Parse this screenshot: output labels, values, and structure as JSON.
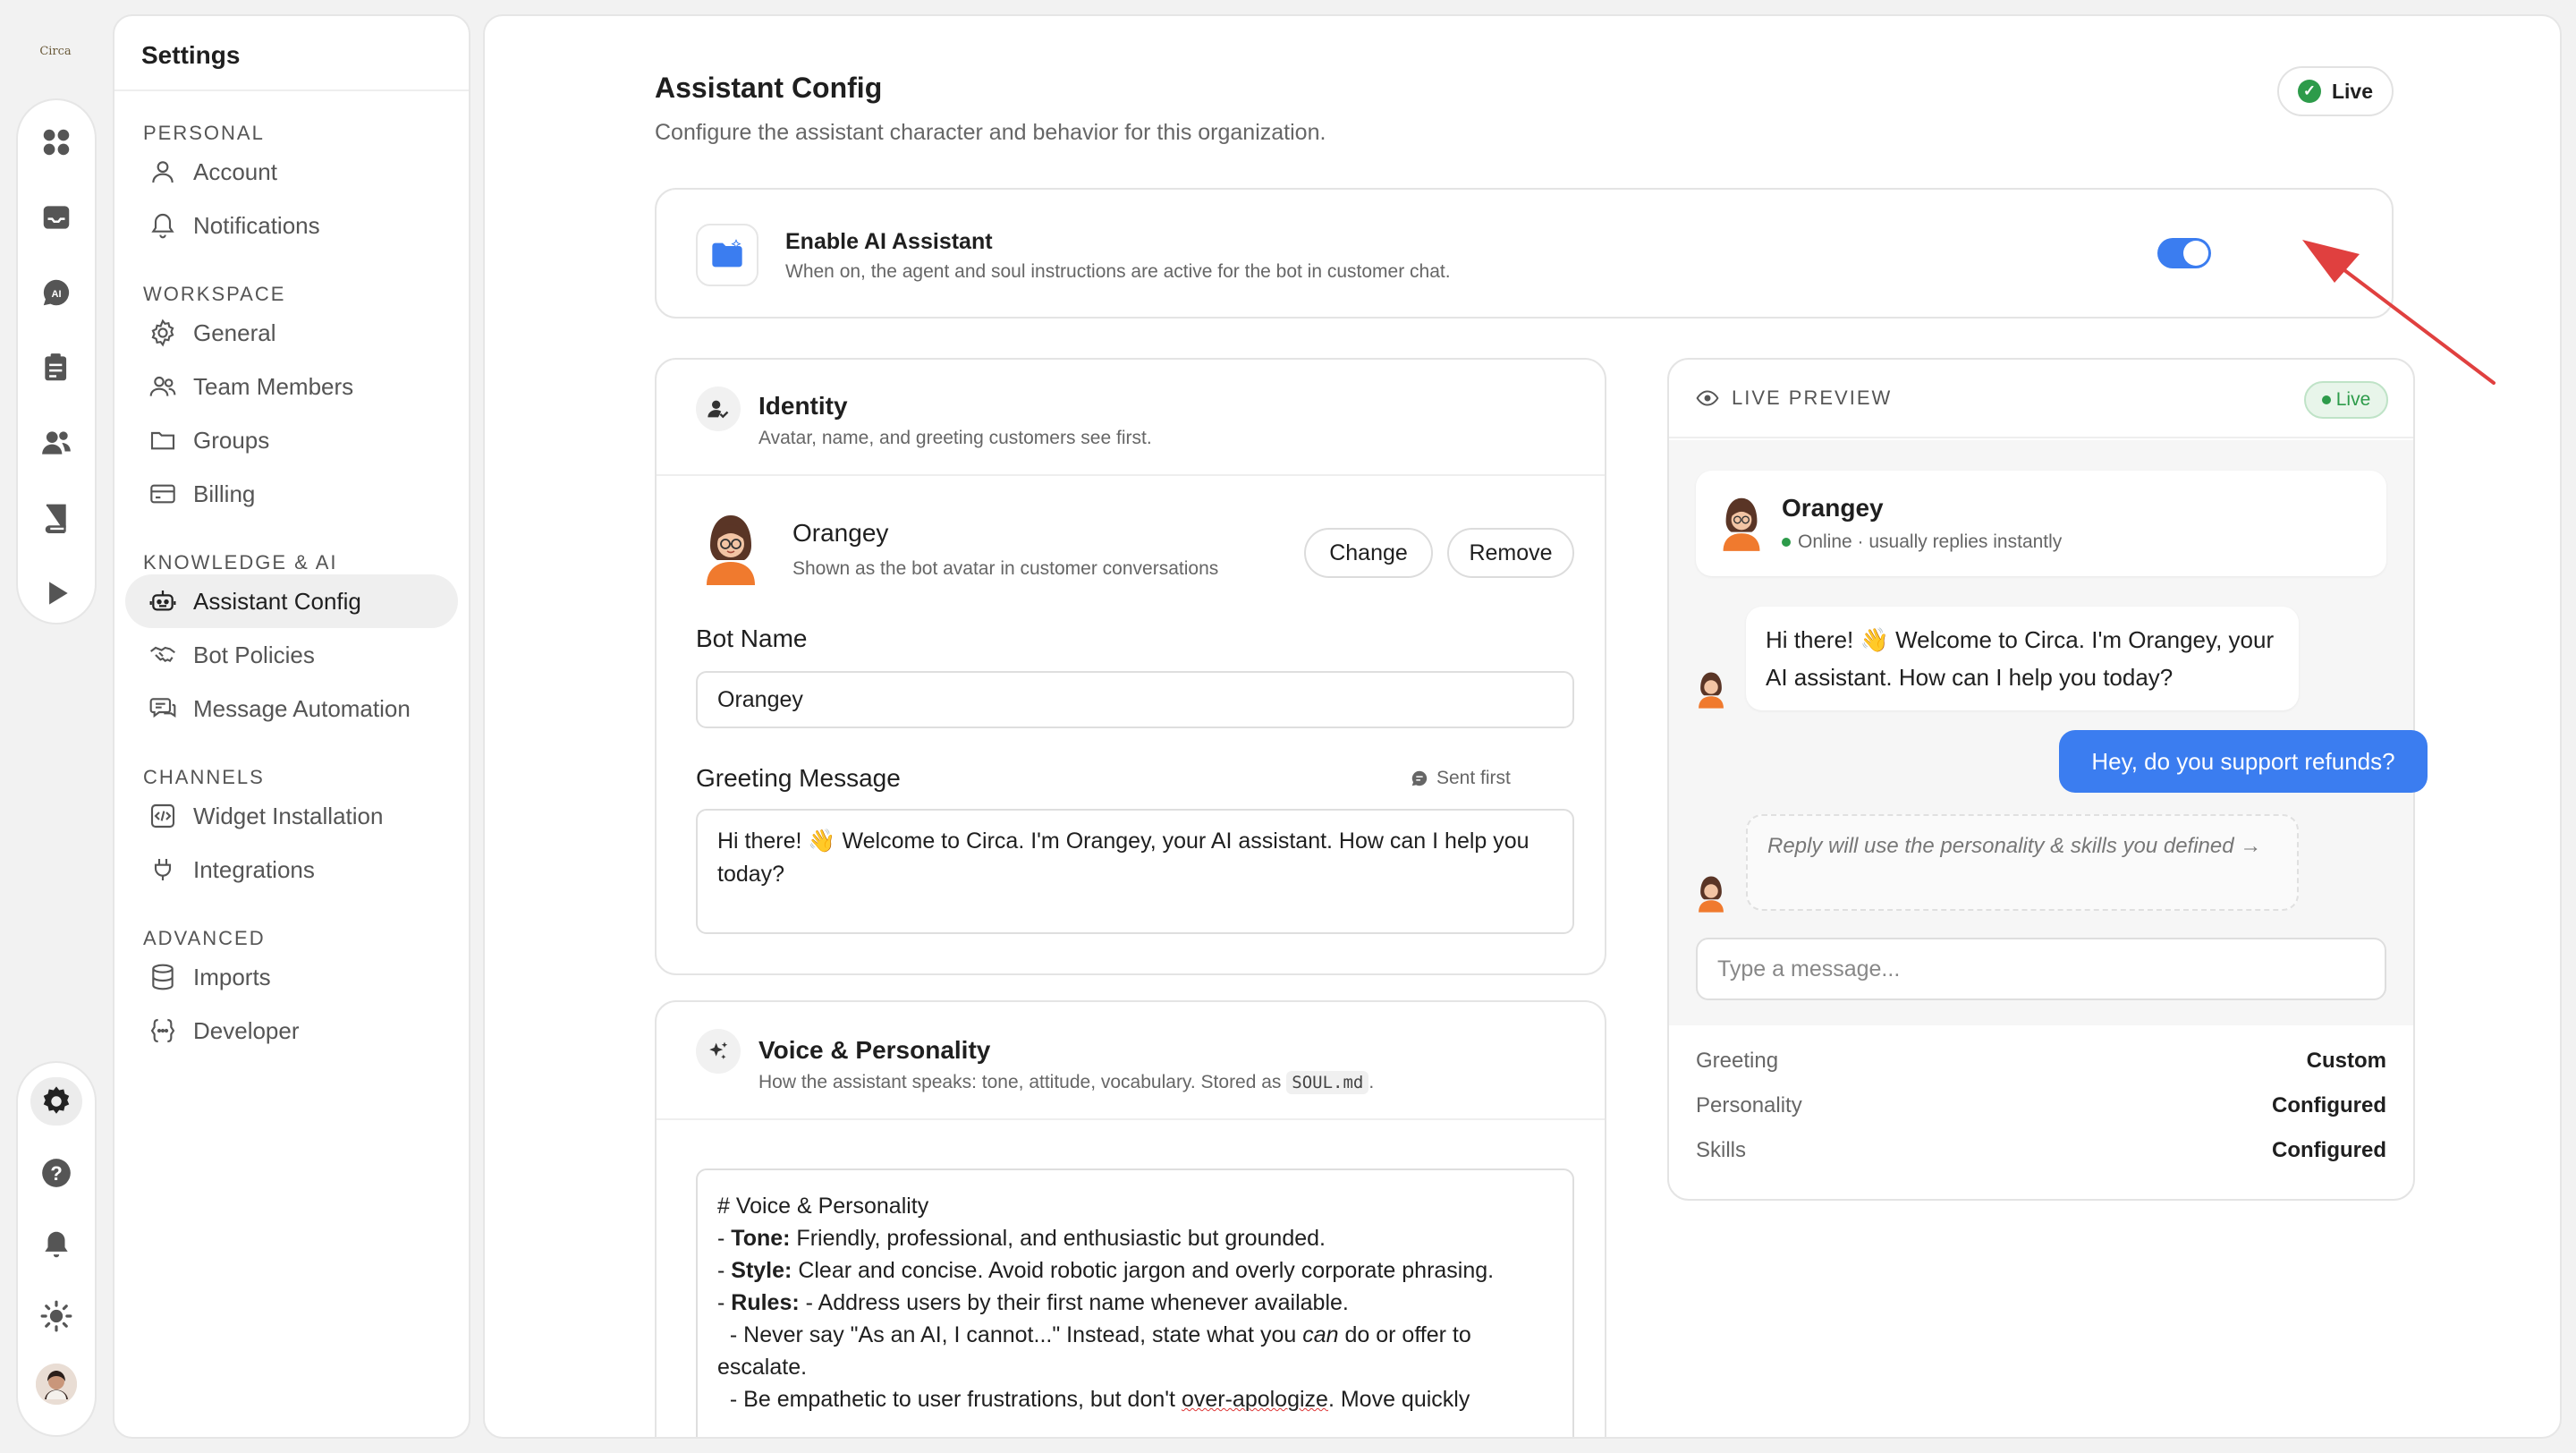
{
  "app": {
    "logo_text": "Circa"
  },
  "settings": {
    "title": "Settings",
    "sections": [
      {
        "label": "PERSONAL",
        "items": [
          {
            "label": "Account",
            "icon": "user-icon"
          },
          {
            "label": "Notifications",
            "icon": "bell-icon"
          }
        ]
      },
      {
        "label": "WORKSPACE",
        "items": [
          {
            "label": "General",
            "icon": "gear-icon"
          },
          {
            "label": "Team Members",
            "icon": "users-icon"
          },
          {
            "label": "Groups",
            "icon": "folder-icon"
          },
          {
            "label": "Billing",
            "icon": "credit-card-icon"
          }
        ]
      },
      {
        "label": "KNOWLEDGE & AI",
        "items": [
          {
            "label": "Assistant Config",
            "icon": "bot-icon",
            "active": true
          },
          {
            "label": "Bot Policies",
            "icon": "handshake-icon"
          },
          {
            "label": "Message Automation",
            "icon": "chat-bubbles-icon"
          }
        ]
      },
      {
        "label": "CHANNELS",
        "items": [
          {
            "label": "Widget Installation",
            "icon": "code-icon"
          },
          {
            "label": "Integrations",
            "icon": "plug-icon"
          }
        ]
      },
      {
        "label": "ADVANCED",
        "items": [
          {
            "label": "Imports",
            "icon": "database-icon"
          },
          {
            "label": "Developer",
            "icon": "braces-icon"
          }
        ]
      }
    ]
  },
  "page": {
    "title": "Assistant Config",
    "subtitle": "Configure the assistant character and behavior for this organization.",
    "status": "Live"
  },
  "enable": {
    "title": "Enable AI Assistant",
    "description": "When on, the agent and soul instructions are active for the bot in customer chat.",
    "enabled": true
  },
  "identity": {
    "title": "Identity",
    "description": "Avatar, name, and greeting customers see first.",
    "bot_name": "Orangey",
    "avatar_caption": "Shown as the bot avatar in customer conversations",
    "change_label": "Change",
    "remove_label": "Remove",
    "bot_name_label": "Bot Name",
    "bot_name_value": "Orangey",
    "greeting_label": "Greeting Message",
    "greeting_hint": "Sent first",
    "greeting_value": "Hi there! 👋 Welcome to Circa. I'm Orangey, your AI assistant. How can I help you today?"
  },
  "voice": {
    "title": "Voice & Personality",
    "description_pre": "How the assistant speaks: tone, attitude, vocabulary. Stored as",
    "description_file": "SOUL.md",
    "description_post": ".",
    "heading": "# Voice & Personality",
    "tone_key": "Tone:",
    "tone_value": "Friendly, professional, and enthusiastic but grounded.",
    "style_key": "Style:",
    "style_value": "Clear and concise. Avoid robotic jargon and overly corporate phrasing.",
    "rules_key": "Rules:",
    "rules_value": "- Address users by their first name whenever available.",
    "rule2_pre": "  - Never say \"As an AI, I cannot...\" Instead, state what you",
    "rule2_em": "can",
    "rule2_post": "do or offer to escalate.",
    "rule3_pre": "  - Be empathetic to user frustrations, but don't",
    "rule3_err": "over-apologize",
    "rule3_post": ". Move quickly"
  },
  "preview": {
    "label": "LIVE PREVIEW",
    "status": "Live",
    "bot_name": "Orangey",
    "bot_status": "Online · usually replies instantly",
    "bot_message": "Hi there! 👋 Welcome to Circa. I'm Orangey, your AI assistant. How can I help you today?",
    "user_message": "Hey, do you support refunds?",
    "hint_message": "Reply will use the personality & skills you defined →",
    "input_placeholder": "Type a message...",
    "summary": [
      {
        "key": "Greeting",
        "value": "Custom"
      },
      {
        "key": "Personality",
        "value": "Configured"
      },
      {
        "key": "Skills",
        "value": "Configured"
      }
    ]
  },
  "colors": {
    "accent": "#3b7df0",
    "success": "#2d9b4a",
    "annotation_arrow": "#e0403f"
  }
}
